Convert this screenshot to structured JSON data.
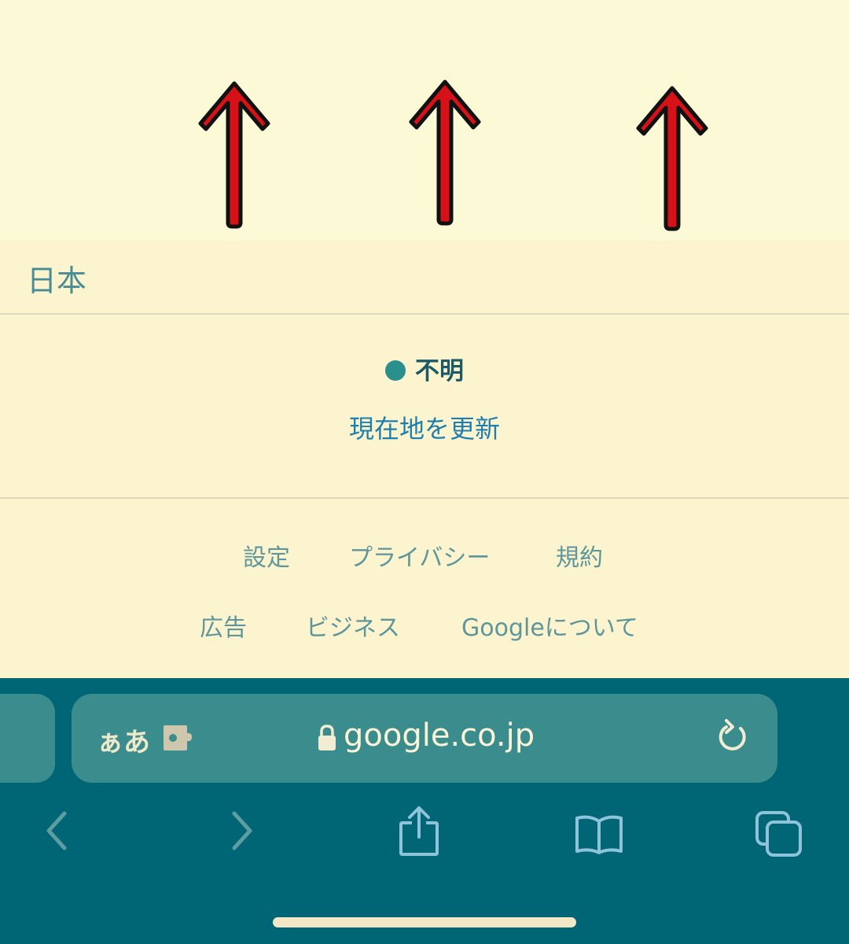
{
  "colors": {
    "background": "#fcfad6",
    "page": "#fbf4cf",
    "browser_bar": "#006676",
    "address_bar": "#3b8c8c",
    "arrow_fill": "#d71118",
    "link": "#1e7fae",
    "status_dot": "#2b8f8e"
  },
  "annotation": {
    "arrows": [
      {
        "icon": "red-up-arrow-icon"
      },
      {
        "icon": "red-up-arrow-icon"
      },
      {
        "icon": "red-up-arrow-icon"
      }
    ]
  },
  "footer": {
    "country": "日本",
    "location_status": "不明",
    "update_location": "現在地を更新",
    "links_row1": [
      "設定",
      "プライバシー",
      "規約"
    ],
    "links_row2": [
      "広告",
      "ビジネス",
      "Googleについて"
    ]
  },
  "browser": {
    "text_size_label": "ぁあ",
    "extension_icon": "puzzle-piece-icon",
    "url": "google.co.jp",
    "icons": [
      "back-icon",
      "forward-icon",
      "share-icon",
      "bookmarks-icon",
      "tabs-icon"
    ]
  }
}
